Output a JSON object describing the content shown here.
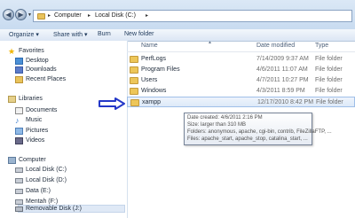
{
  "address": {
    "crumbs": [
      "Computer",
      "Local Disk (C:)"
    ]
  },
  "toolbar": {
    "organize": "Organize ▾",
    "share": "Share with ▾",
    "burn": "Burn",
    "new_folder": "New folder"
  },
  "nav": {
    "favorites": "Favorites",
    "desktop": "Desktop",
    "downloads": "Downloads",
    "recent": "Recent Places",
    "libraries": "Libraries",
    "documents": "Documents",
    "music": "Music",
    "pictures": "Pictures",
    "videos": "Videos",
    "computer": "Computer",
    "c": "Local Disk (C:)",
    "d": "Local Disk (D:)",
    "e": "Data (E:)",
    "f": "Mentah (F:)",
    "j": "Removable Disk (J:)"
  },
  "columns": {
    "name": "Name",
    "date": "Date modified",
    "type": "Type"
  },
  "files": [
    {
      "name": "PerfLogs",
      "date": "7/14/2009 9:37 AM",
      "type": "File folder"
    },
    {
      "name": "Program Files",
      "date": "4/6/2011 11:07 AM",
      "type": "File folder"
    },
    {
      "name": "Users",
      "date": "4/7/2011 10:27 PM",
      "type": "File folder"
    },
    {
      "name": "Windows",
      "date": "4/3/2011 8:59 PM",
      "type": "File folder"
    },
    {
      "name": "xampp",
      "date": "12/17/2010 8:42 PM",
      "type": "File folder"
    }
  ],
  "tooltip": {
    "l1": "Date created: 4/6/2011 2:16 PM",
    "l2": "Size: larger than 310 MB",
    "l3": "Folders: anonymous, apache, cgi-bin, contrib, FileZillaFTP, ...",
    "l4": "Files: apache_start, apache_stop, catalina_start, ..."
  },
  "colors": {
    "arrow": "#2438c8",
    "selection": "#dde9f8"
  }
}
